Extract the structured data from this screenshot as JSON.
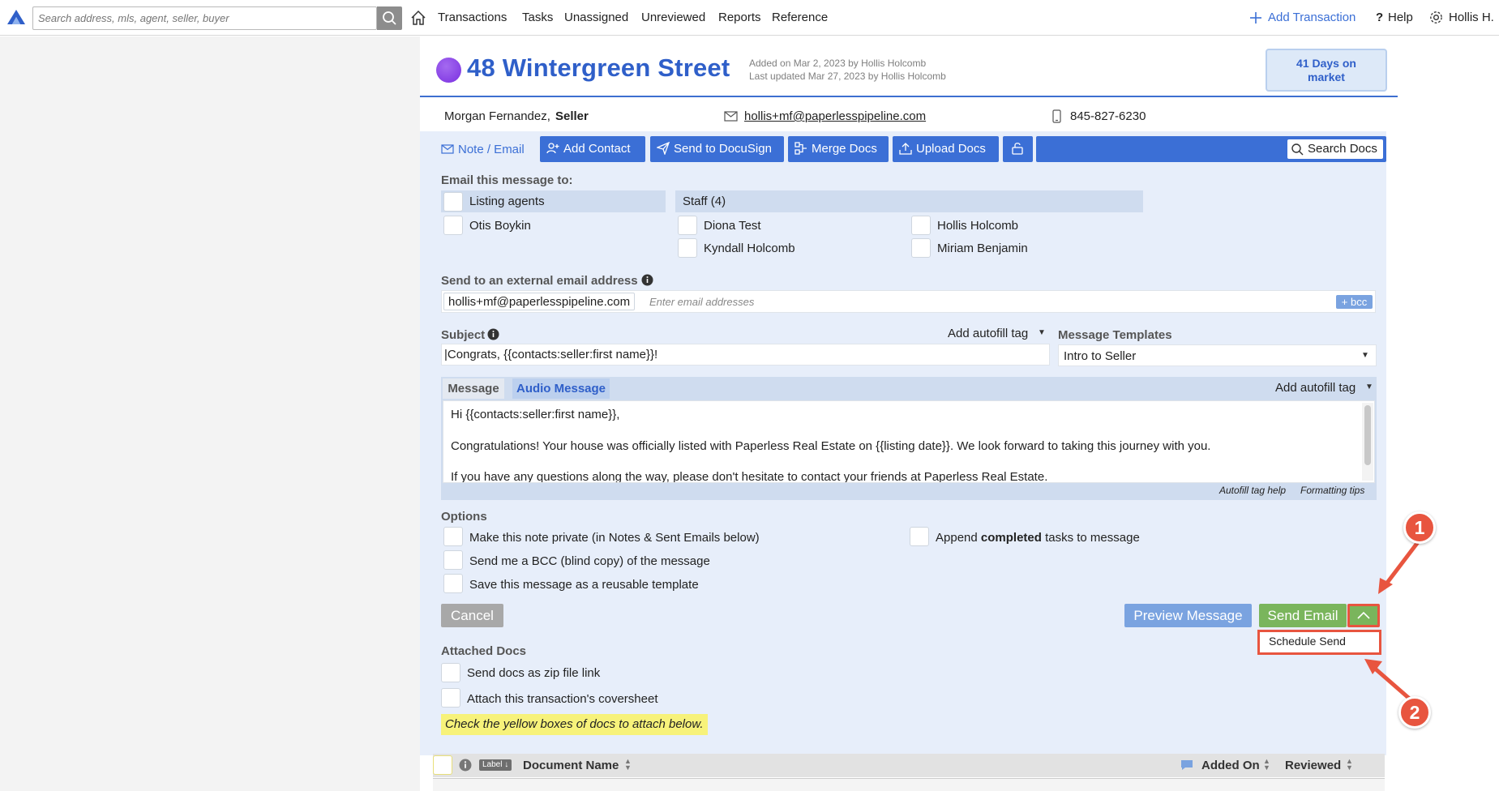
{
  "topbar": {
    "search_placeholder": "Search address, mls, agent, seller, buyer",
    "nav": [
      "Transactions",
      "Tasks",
      "Unassigned",
      "Unreviewed",
      "Reports",
      "Reference"
    ],
    "add_transaction": "Add Transaction",
    "help": "Help",
    "user": "Hollis H.",
    "icons": [
      "paperless-pipeline-logo-icon",
      "search-icon",
      "home-icon",
      "plus-icon",
      "question-icon",
      "gear-icon"
    ]
  },
  "transaction": {
    "address": "48 Wintergreen Street",
    "added_on": "Added on Mar 2, 2023 by Hollis Holcomb",
    "last_updated": "Last updated Mar 27, 2023 by Hollis Holcomb",
    "days_on_market": "41 Days on market",
    "status_color": "#8a3fe8"
  },
  "contact": {
    "name": "Morgan Fernandez,",
    "role": "Seller",
    "email": "hollis+mf@paperlesspipeline.com",
    "phone": "845-827-6230"
  },
  "toolbar": {
    "note_email": "Note / Email",
    "add_contact": "Add Contact",
    "send_docusign": "Send to DocuSign",
    "merge_docs": "Merge Docs",
    "upload_docs": "Upload Docs",
    "search_docs": "Search Docs"
  },
  "email_form": {
    "email_to_label": "Email this message to:",
    "listing_agents": "Listing agents",
    "agents": [
      "Otis Boykin"
    ],
    "staff_header": "Staff (4)",
    "staff": [
      "Diona Test",
      "Hollis Holcomb",
      "Kyndall Holcomb",
      "Miriam Benjamin"
    ],
    "external_label": "Send to an external email address",
    "external_chip": "hollis+mf@paperlesspipeline.com",
    "external_placeholder": "Enter email addresses",
    "bcc_button": "+ bcc",
    "subject_label": "Subject",
    "subject_value": "|Congrats, {{contacts:seller:first name}}!",
    "add_autofill_tag": "Add autofill tag",
    "templates_label": "Message Templates",
    "template_value": "Intro to Seller",
    "message_tab": "Message",
    "audio_tab": "Audio Message",
    "message_lines": [
      "Hi {{contacts:seller:first name}},",
      "Congratulations! Your house was officially listed with Paperless Real Estate on {{listing date}}. We look forward to taking this journey with you.",
      "If you have any questions along the way, please don't hesitate to contact your friends at Paperless Real Estate."
    ],
    "autofill_help": "Autofill tag help",
    "formatting_tips": "Formatting tips"
  },
  "options": {
    "label": "Options",
    "private": "Make this note private (in Notes & Sent Emails below)",
    "bcc_me": "Send me a BCC (blind copy) of the message",
    "save_template": "Save this message as a reusable template",
    "append_prefix": "Append ",
    "append_bold": "completed",
    "append_suffix": " tasks to message"
  },
  "actions": {
    "cancel": "Cancel",
    "preview": "Preview Message",
    "send_email": "Send Email",
    "schedule_send": "Schedule Send"
  },
  "attached": {
    "label": "Attached Docs",
    "zip": "Send docs as zip file link",
    "coversheet": "Attach this transaction's coversheet",
    "hint": "Check the yellow boxes of docs to attach below."
  },
  "table": {
    "label_chip": "Label",
    "document_name": "Document Name",
    "added_on": "Added On",
    "reviewed": "Reviewed"
  },
  "callouts": [
    "1",
    "2"
  ],
  "colors": {
    "brand_blue": "#3b6fd6",
    "panel_bg": "#e7eefa",
    "send_green": "#7ab55c",
    "preview_blue": "#7aa3e0",
    "callout_red": "#e8553f"
  }
}
